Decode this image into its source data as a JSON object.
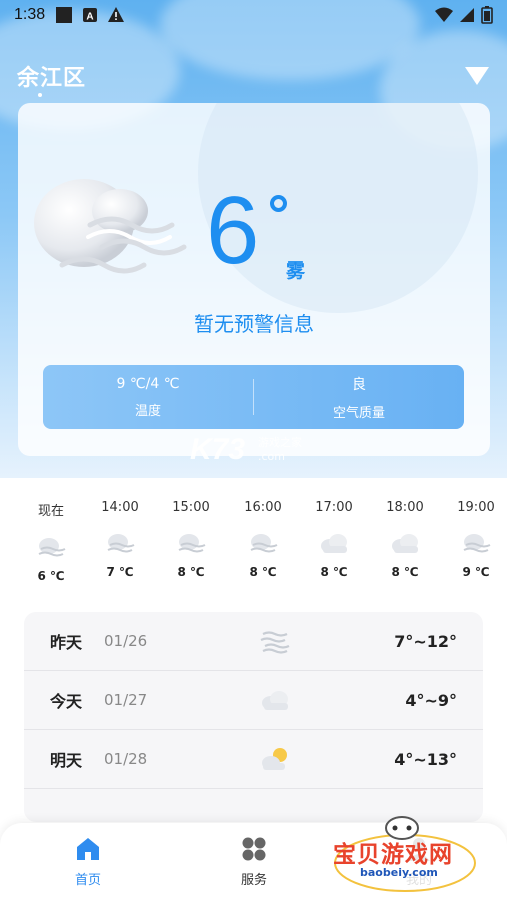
{
  "status_bar": {
    "time": "1:38",
    "icons_left": [
      "square-icon",
      "a-box-icon",
      "warning-icon"
    ],
    "icons_right": [
      "wifi-icon",
      "signal-icon",
      "battery-icon"
    ]
  },
  "header": {
    "location": "余江区",
    "menu_icon": "triangle-down-icon"
  },
  "current": {
    "temperature": "6",
    "condition": "雾",
    "warning_text": "暂无预警信息",
    "icon": "fog-icon",
    "stats": [
      {
        "value": "9 ℃/4 ℃",
        "label": "温度"
      },
      {
        "value": "良",
        "label": "空气质量"
      }
    ]
  },
  "watermark": {
    "k73": "K73",
    "k73_sub_1": "游戏之家",
    "k73_sub_2": ".com",
    "brand": "宝贝游戏网",
    "brand_sub": "baobeiy.com"
  },
  "hourly": [
    {
      "time": "现在",
      "temp": "6 ℃",
      "icon": "fog-icon"
    },
    {
      "time": "14:00",
      "temp": "7 ℃",
      "icon": "fog-icon"
    },
    {
      "time": "15:00",
      "temp": "8 ℃",
      "icon": "fog-icon"
    },
    {
      "time": "16:00",
      "temp": "8 ℃",
      "icon": "fog-icon"
    },
    {
      "time": "17:00",
      "temp": "8 ℃",
      "icon": "cloudy-icon"
    },
    {
      "time": "18:00",
      "temp": "8 ℃",
      "icon": "cloudy-icon"
    },
    {
      "time": "19:00",
      "temp": "9 ℃",
      "icon": "fog-icon"
    }
  ],
  "daily": [
    {
      "day": "昨天",
      "date": "01/26",
      "range": "7°~12°",
      "icon": "fog-icon"
    },
    {
      "day": "今天",
      "date": "01/27",
      "range": "4°~9°",
      "icon": "cloudy-icon"
    },
    {
      "day": "明天",
      "date": "01/28",
      "range": "4°~13°",
      "icon": "partly-sunny-icon"
    }
  ],
  "nav": [
    {
      "label": "首页",
      "icon": "home-icon",
      "active": true
    },
    {
      "label": "服务",
      "icon": "grid-icon",
      "active": false
    },
    {
      "label": "我的",
      "icon": "user-icon",
      "active": false
    }
  ],
  "colors": {
    "accent": "#1e8ef0",
    "nav_active": "#2f8cef"
  }
}
